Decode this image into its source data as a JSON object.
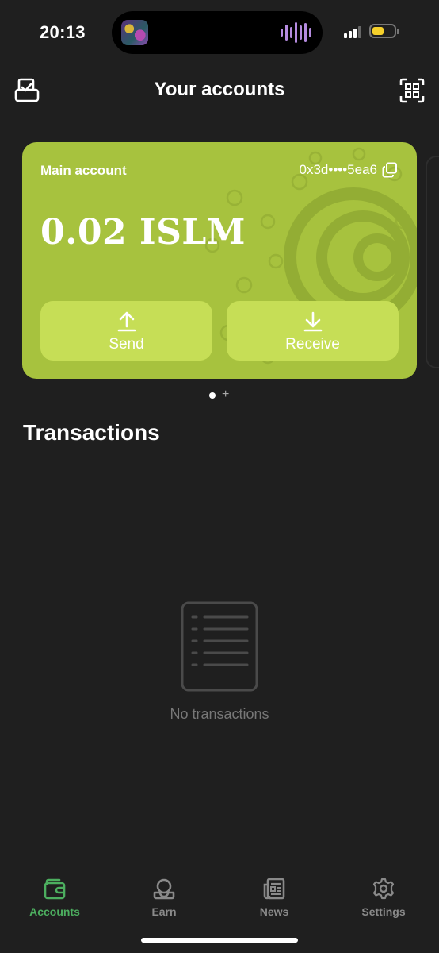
{
  "status_bar": {
    "time": "20:13",
    "battery_color": "#f5d02b"
  },
  "header": {
    "title": "Your accounts",
    "left_icon": "wallet-check-icon",
    "right_icon": "qr-scan-icon"
  },
  "account_card": {
    "name": "Main account",
    "address": "0x3d••••5ea6",
    "balance": "0.02 ISLM",
    "background_color": "#a7c23e",
    "send_label": "Send",
    "receive_label": "Receive"
  },
  "transactions": {
    "title": "Transactions",
    "empty_text": "No transactions"
  },
  "tab_bar": {
    "active_color": "#4cae5f",
    "items": [
      {
        "label": "Accounts",
        "icon": "wallet-icon"
      },
      {
        "label": "Earn",
        "icon": "earn-icon"
      },
      {
        "label": "News",
        "icon": "news-icon"
      },
      {
        "label": "Settings",
        "icon": "gear-icon"
      }
    ]
  }
}
